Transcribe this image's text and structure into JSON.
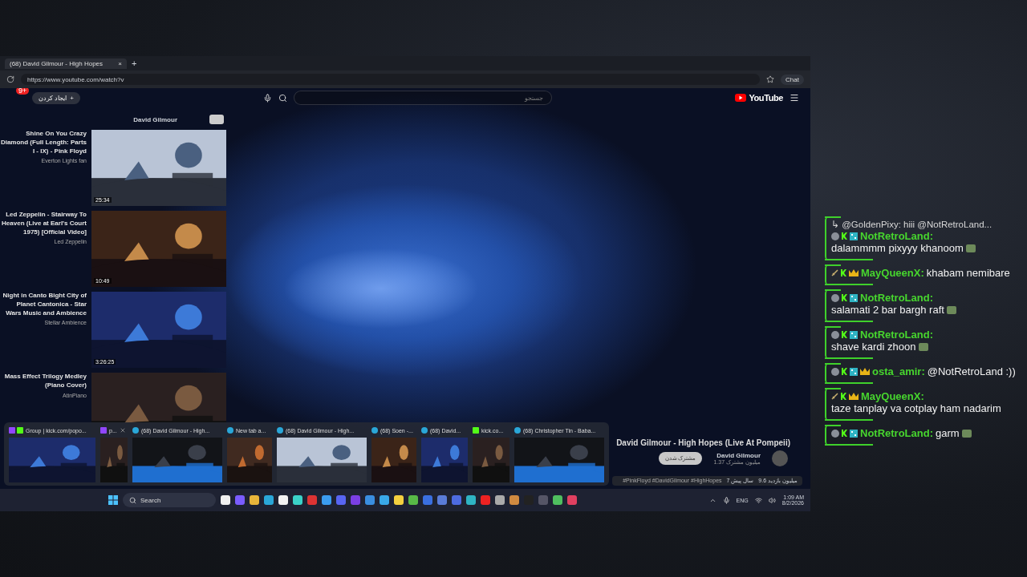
{
  "browser": {
    "tab": {
      "title": "(68) David Gilmour - High Hopes",
      "close": "×",
      "new_tab": "+"
    },
    "url": "https://www.youtube.com/watch?v",
    "chat_button": "Chat"
  },
  "youtube": {
    "create": {
      "label": "ایجاد کردن",
      "icon": "+"
    },
    "notifications": "9+",
    "search": {
      "placeholder": "جستجو"
    },
    "logo": "YouTube"
  },
  "playlist": {
    "header": "David Gilmour",
    "items": [
      {
        "title": "Shine On You Crazy Diamond (Full Length: Parts I - IX) - Pink Floyd",
        "channel": "Everton Lights fan",
        "duration": "25:34"
      },
      {
        "title": "Led Zeppelin - Stairway To Heaven (Live at Earl's Court 1975) [Official Video]",
        "channel": "Led Zeppelin",
        "duration": "10:49"
      },
      {
        "title": "Night in Canto Bight City of Planet Cantonica - Star Wars Music and Ambience",
        "channel": "Stellar Ambience",
        "duration": "3:26:25"
      },
      {
        "title": "Mass Effect Trilogy Medley (Piano Cover)",
        "channel": "AtinPiano"
      }
    ]
  },
  "video": {
    "title": "David Gilmour - High Hopes (Live At Pompeii)",
    "channel": "David Gilmour",
    "subscribers": "1.37 میلیون مشترک",
    "subscribe": "مشترک شدن",
    "views": "9.6 میلیون بازدید",
    "age": "7 سال پیش",
    "tags": "#PinkFloyd #DavidGilmour #HighHopes"
  },
  "window_previews": [
    {
      "kind": "group",
      "title": "Group | kick.com/popo..."
    },
    {
      "kind": "twitch",
      "title": "p..."
    },
    {
      "kind": "edge",
      "title": "(68) David Gilmour - High..."
    },
    {
      "kind": "edge",
      "title": "New tab a..."
    },
    {
      "kind": "edge",
      "title": "(68) David Gilmour - High..."
    },
    {
      "kind": "edge",
      "title": "(68) Soen -..."
    },
    {
      "kind": "edge",
      "title": "(68) David..."
    },
    {
      "kind": "kick",
      "title": "kick.co..."
    },
    {
      "kind": "edge",
      "title": "(68) Christopher Tin - Baba..."
    }
  ],
  "taskbar": {
    "search": "Search",
    "language": "ENG",
    "time": "1:09 AM",
    "date": "8/2/2026"
  },
  "chat": [
    {
      "kind": "stacked",
      "reply": "↳ @GoldenPixy: hiii @NotRetroLand...",
      "user": "NotRetroLand:",
      "badges": [
        {
          "kind": "avatar"
        },
        {
          "kind": "kick"
        },
        {
          "kind": "grid"
        }
      ],
      "text": "dalammmm pixyyy khanoom",
      "emote": true
    },
    {
      "kind": "inline",
      "user": "MayQueenX:",
      "badges": [
        {
          "kind": "sword"
        },
        {
          "kind": "kick"
        },
        {
          "kind": "crown"
        }
      ],
      "text": "khabam nemibare",
      "emote": false
    },
    {
      "kind": "stacked",
      "user": "NotRetroLand:",
      "badges": [
        {
          "kind": "avatar"
        },
        {
          "kind": "kick"
        },
        {
          "kind": "grid"
        }
      ],
      "text": "salamati 2 bar bargh raft",
      "emote": true
    },
    {
      "kind": "stacked",
      "user": "NotRetroLand:",
      "badges": [
        {
          "kind": "avatar"
        },
        {
          "kind": "kick"
        },
        {
          "kind": "grid"
        }
      ],
      "text": "shave kardi zhoon",
      "emote": true
    },
    {
      "kind": "inline",
      "user": "osta_amir:",
      "badges": [
        {
          "kind": "avatar"
        },
        {
          "kind": "kick"
        },
        {
          "kind": "grid"
        },
        {
          "kind": "crown"
        }
      ],
      "text": "@NotRetroLand :))",
      "emote": false
    },
    {
      "kind": "stacked",
      "user": "MayQueenX:",
      "badges": [
        {
          "kind": "sword"
        },
        {
          "kind": "kick"
        },
        {
          "kind": "crown"
        }
      ],
      "text": "taze tanplay va cotplay ham nadarim",
      "emote": false
    },
    {
      "kind": "inline",
      "user": "NotRetroLand:",
      "badges": [
        {
          "kind": "avatar"
        },
        {
          "kind": "kick"
        },
        {
          "kind": "grid"
        }
      ],
      "text": "garm",
      "emote": true
    }
  ]
}
